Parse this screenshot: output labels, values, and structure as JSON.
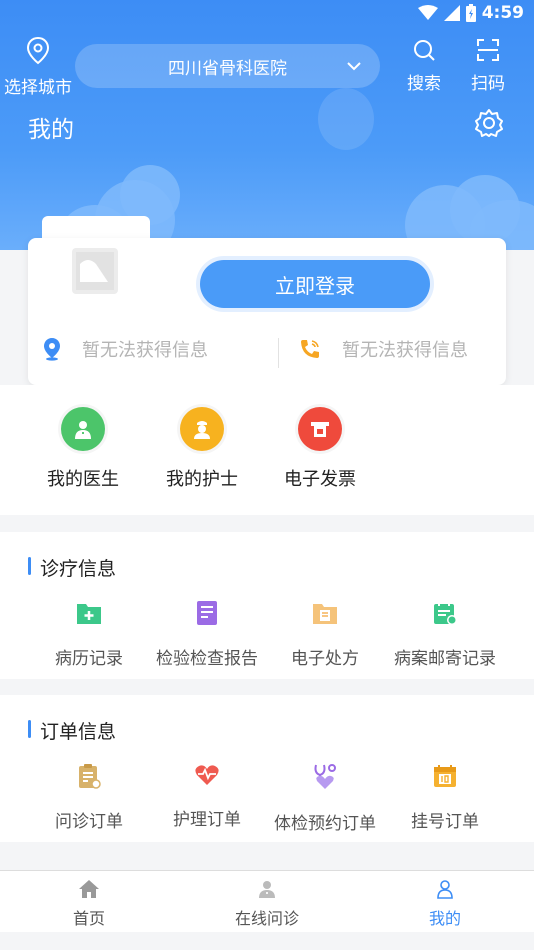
{
  "status_bar": {
    "time": "4:59"
  },
  "header": {
    "city_label": "选择城市",
    "hospital": "四川省骨科医院",
    "search_label": "搜索",
    "scan_label": "扫码",
    "title": "我的"
  },
  "login_card": {
    "login_button": "立即登录",
    "location_info": "暂无法获得信息",
    "phone_info": "暂无法获得信息"
  },
  "quick_actions": [
    {
      "label": "我的医生",
      "color": "#4cc56a"
    },
    {
      "label": "我的护士",
      "color": "#f7b21f"
    },
    {
      "label": "电子发票",
      "color": "#ef4a3c"
    }
  ],
  "diagnosis": {
    "title": "诊疗信息",
    "items": [
      {
        "label": "病历记录",
        "icon": "folder-plus-icon",
        "color": "#3cc88a"
      },
      {
        "label": "检验检查报告",
        "icon": "report-icon",
        "color": "#9b6be5"
      },
      {
        "label": "电子处方",
        "icon": "prescription-icon",
        "color": "#f5b45a"
      },
      {
        "label": "病案邮寄记录",
        "icon": "calendar-icon",
        "color": "#3cc88a"
      }
    ]
  },
  "orders": {
    "title": "订单信息",
    "items": [
      {
        "label": "问诊订单",
        "icon": "clipboard-icon",
        "color": "#d8b26a"
      },
      {
        "label": "护理订单",
        "icon": "heart-pulse-icon",
        "color": "#ef5a50"
      },
      {
        "label": "体检预约订单",
        "icon": "stethoscope-icon",
        "color": "#9b6be5"
      },
      {
        "label": "挂号订单",
        "icon": "calendar-10-icon",
        "color": "#f5b130"
      }
    ]
  },
  "bottom_nav": [
    {
      "label": "首页",
      "active": false
    },
    {
      "label": "在线问诊",
      "active": false
    },
    {
      "label": "我的",
      "active": true
    }
  ]
}
